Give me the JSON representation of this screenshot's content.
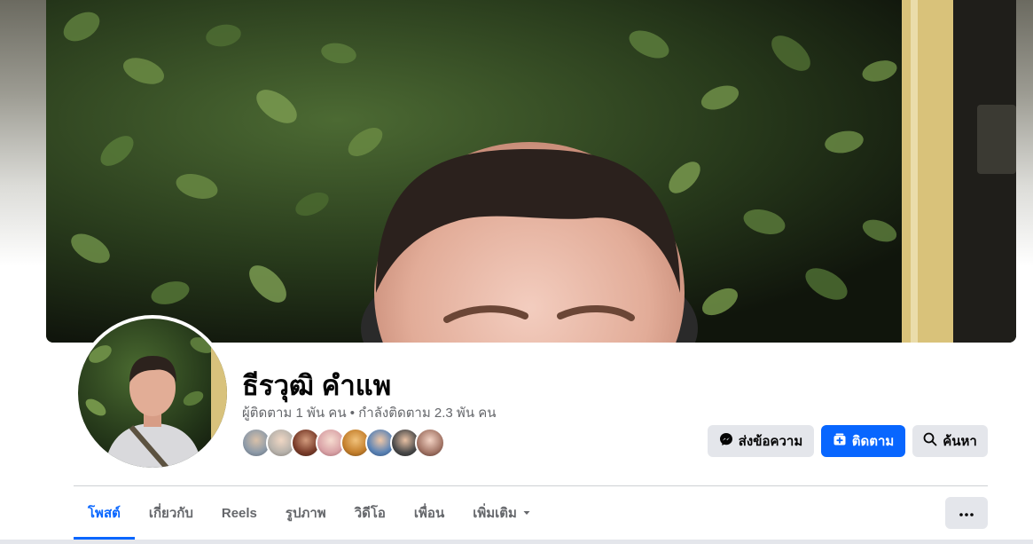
{
  "profile": {
    "name": "ธีรวุฒิ คำแพ",
    "stats": "ผู้ติดตาม 1 พัน คน • กำลังติดตาม 2.3 พัน คน"
  },
  "actions": {
    "message_label": "ส่งข้อความ",
    "follow_label": "ติดตาม",
    "search_label": "ค้นหา"
  },
  "tabs": [
    {
      "label": "โพสต์",
      "active": true
    },
    {
      "label": "เกี่ยวกับ",
      "active": false
    },
    {
      "label": "Reels",
      "active": false
    },
    {
      "label": "รูปภาพ",
      "active": false
    },
    {
      "label": "วิดีโอ",
      "active": false
    },
    {
      "label": "เพื่อน",
      "active": false
    },
    {
      "label": "เพิ่มเติม",
      "active": false,
      "has_dropdown": true
    }
  ],
  "icons": {
    "message": "messenger-icon",
    "follow": "follow-icon",
    "search": "search-icon",
    "more": "more-options-icon",
    "dropdown": "caret-down-icon"
  },
  "colors": {
    "accent": "#0866ff",
    "secondary_button": "#e4e6eb",
    "secondary_text": "#65676b"
  }
}
